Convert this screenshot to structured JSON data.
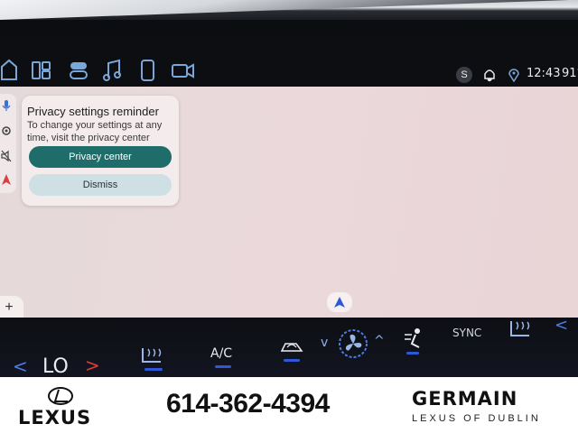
{
  "status_bar": {
    "user_badge": "S",
    "time": "12:43",
    "temperature": "91°"
  },
  "popup": {
    "title": "Privacy settings reminder",
    "body": "To change your settings at any time, visit the privacy center",
    "primary_button": "Privacy center",
    "secondary_button": "Dismiss"
  },
  "map_controls": {
    "zoom_in": "+",
    "zoom_out": "−"
  },
  "climate": {
    "temp_setting": "LO",
    "left_arrow": "<",
    "right_arrow": ">",
    "ac_label": "A/C",
    "sync_label": "SYNC",
    "fan_down": "v",
    "fan_up": "^"
  },
  "footer": {
    "brand": "LEXUS",
    "phone": "614-362-4394",
    "dealer_name": "GERMAIN",
    "dealer_sub": "LEXUS OF DUBLIN"
  },
  "colors": {
    "accent_teal": "#1f6d6a",
    "led_blue": "#2f58d8",
    "icon_blue": "#7aa6d8",
    "climate_arrow_red": "#e03a3a"
  },
  "icons": [
    "home-icon",
    "widgets-icon",
    "toggle-icon",
    "music-icon",
    "phone-icon",
    "camera-icon",
    "notification-bell-icon",
    "location-pin-icon",
    "microphone-icon",
    "settings-icon",
    "mute-icon",
    "navigation-icon",
    "seat-heat-icon",
    "air-recirculation-icon",
    "fan-icon",
    "vent-mode-icon",
    "rear-seat-heat-icon"
  ]
}
